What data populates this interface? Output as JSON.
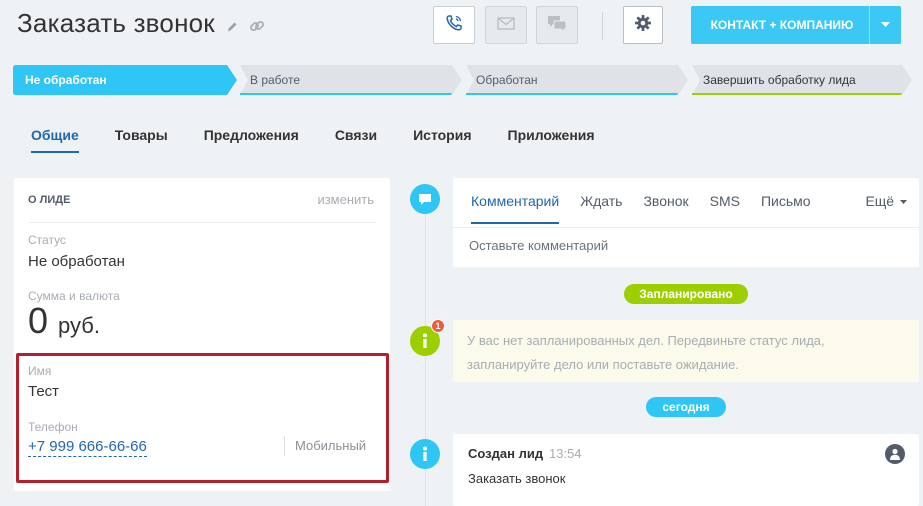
{
  "header": {
    "title": "Заказать звонок",
    "primary_button": "КОНТАКТ + КОМПАНИЮ"
  },
  "stages": [
    {
      "label": "Не обработан",
      "active": true
    },
    {
      "label": "В работе"
    },
    {
      "label": "Обработан"
    },
    {
      "label": "Завершить обработку лида"
    }
  ],
  "tabs": [
    "Общие",
    "Товары",
    "Предложения",
    "Связи",
    "История",
    "Приложения"
  ],
  "lead_card": {
    "heading": "О ЛИДЕ",
    "edit_link": "изменить",
    "status_label": "Статус",
    "status_value": "Не обработан",
    "amount_label": "Сумма и валюта",
    "amount_value": "0",
    "currency": "руб.",
    "name_label": "Имя",
    "name_value": "Тест",
    "phone_label": "Телефон",
    "phone_value": "+7 999 666-66-66",
    "phone_type": "Мобильный"
  },
  "editor": {
    "tabs": [
      "Комментарий",
      "Ждать",
      "Звонок",
      "SMS",
      "Письмо"
    ],
    "more": "Ещё",
    "placeholder": "Оставьте комментарий"
  },
  "timeline": {
    "planned_pill": "Запланировано",
    "notice_badge": "1",
    "notice_text": "У вас нет запланированных дел. Передвиньте статус лида, запланируйте дело или поставьте ожидание.",
    "today_pill": "сегодня",
    "event_title": "Создан лид",
    "event_time": "13:54",
    "event_text": "Заказать звонок"
  },
  "colors": {
    "accent": "#3bc8f5",
    "link": "#2067b0",
    "planned_green": "#9dcf00",
    "highlight_red": "#b41f2a"
  },
  "icons": [
    "pencil-icon",
    "link-icon",
    "phone-icon",
    "mail-icon",
    "chat-icon",
    "gear-icon",
    "chevron-down-icon",
    "comment-icon",
    "info-icon",
    "user-icon"
  ]
}
